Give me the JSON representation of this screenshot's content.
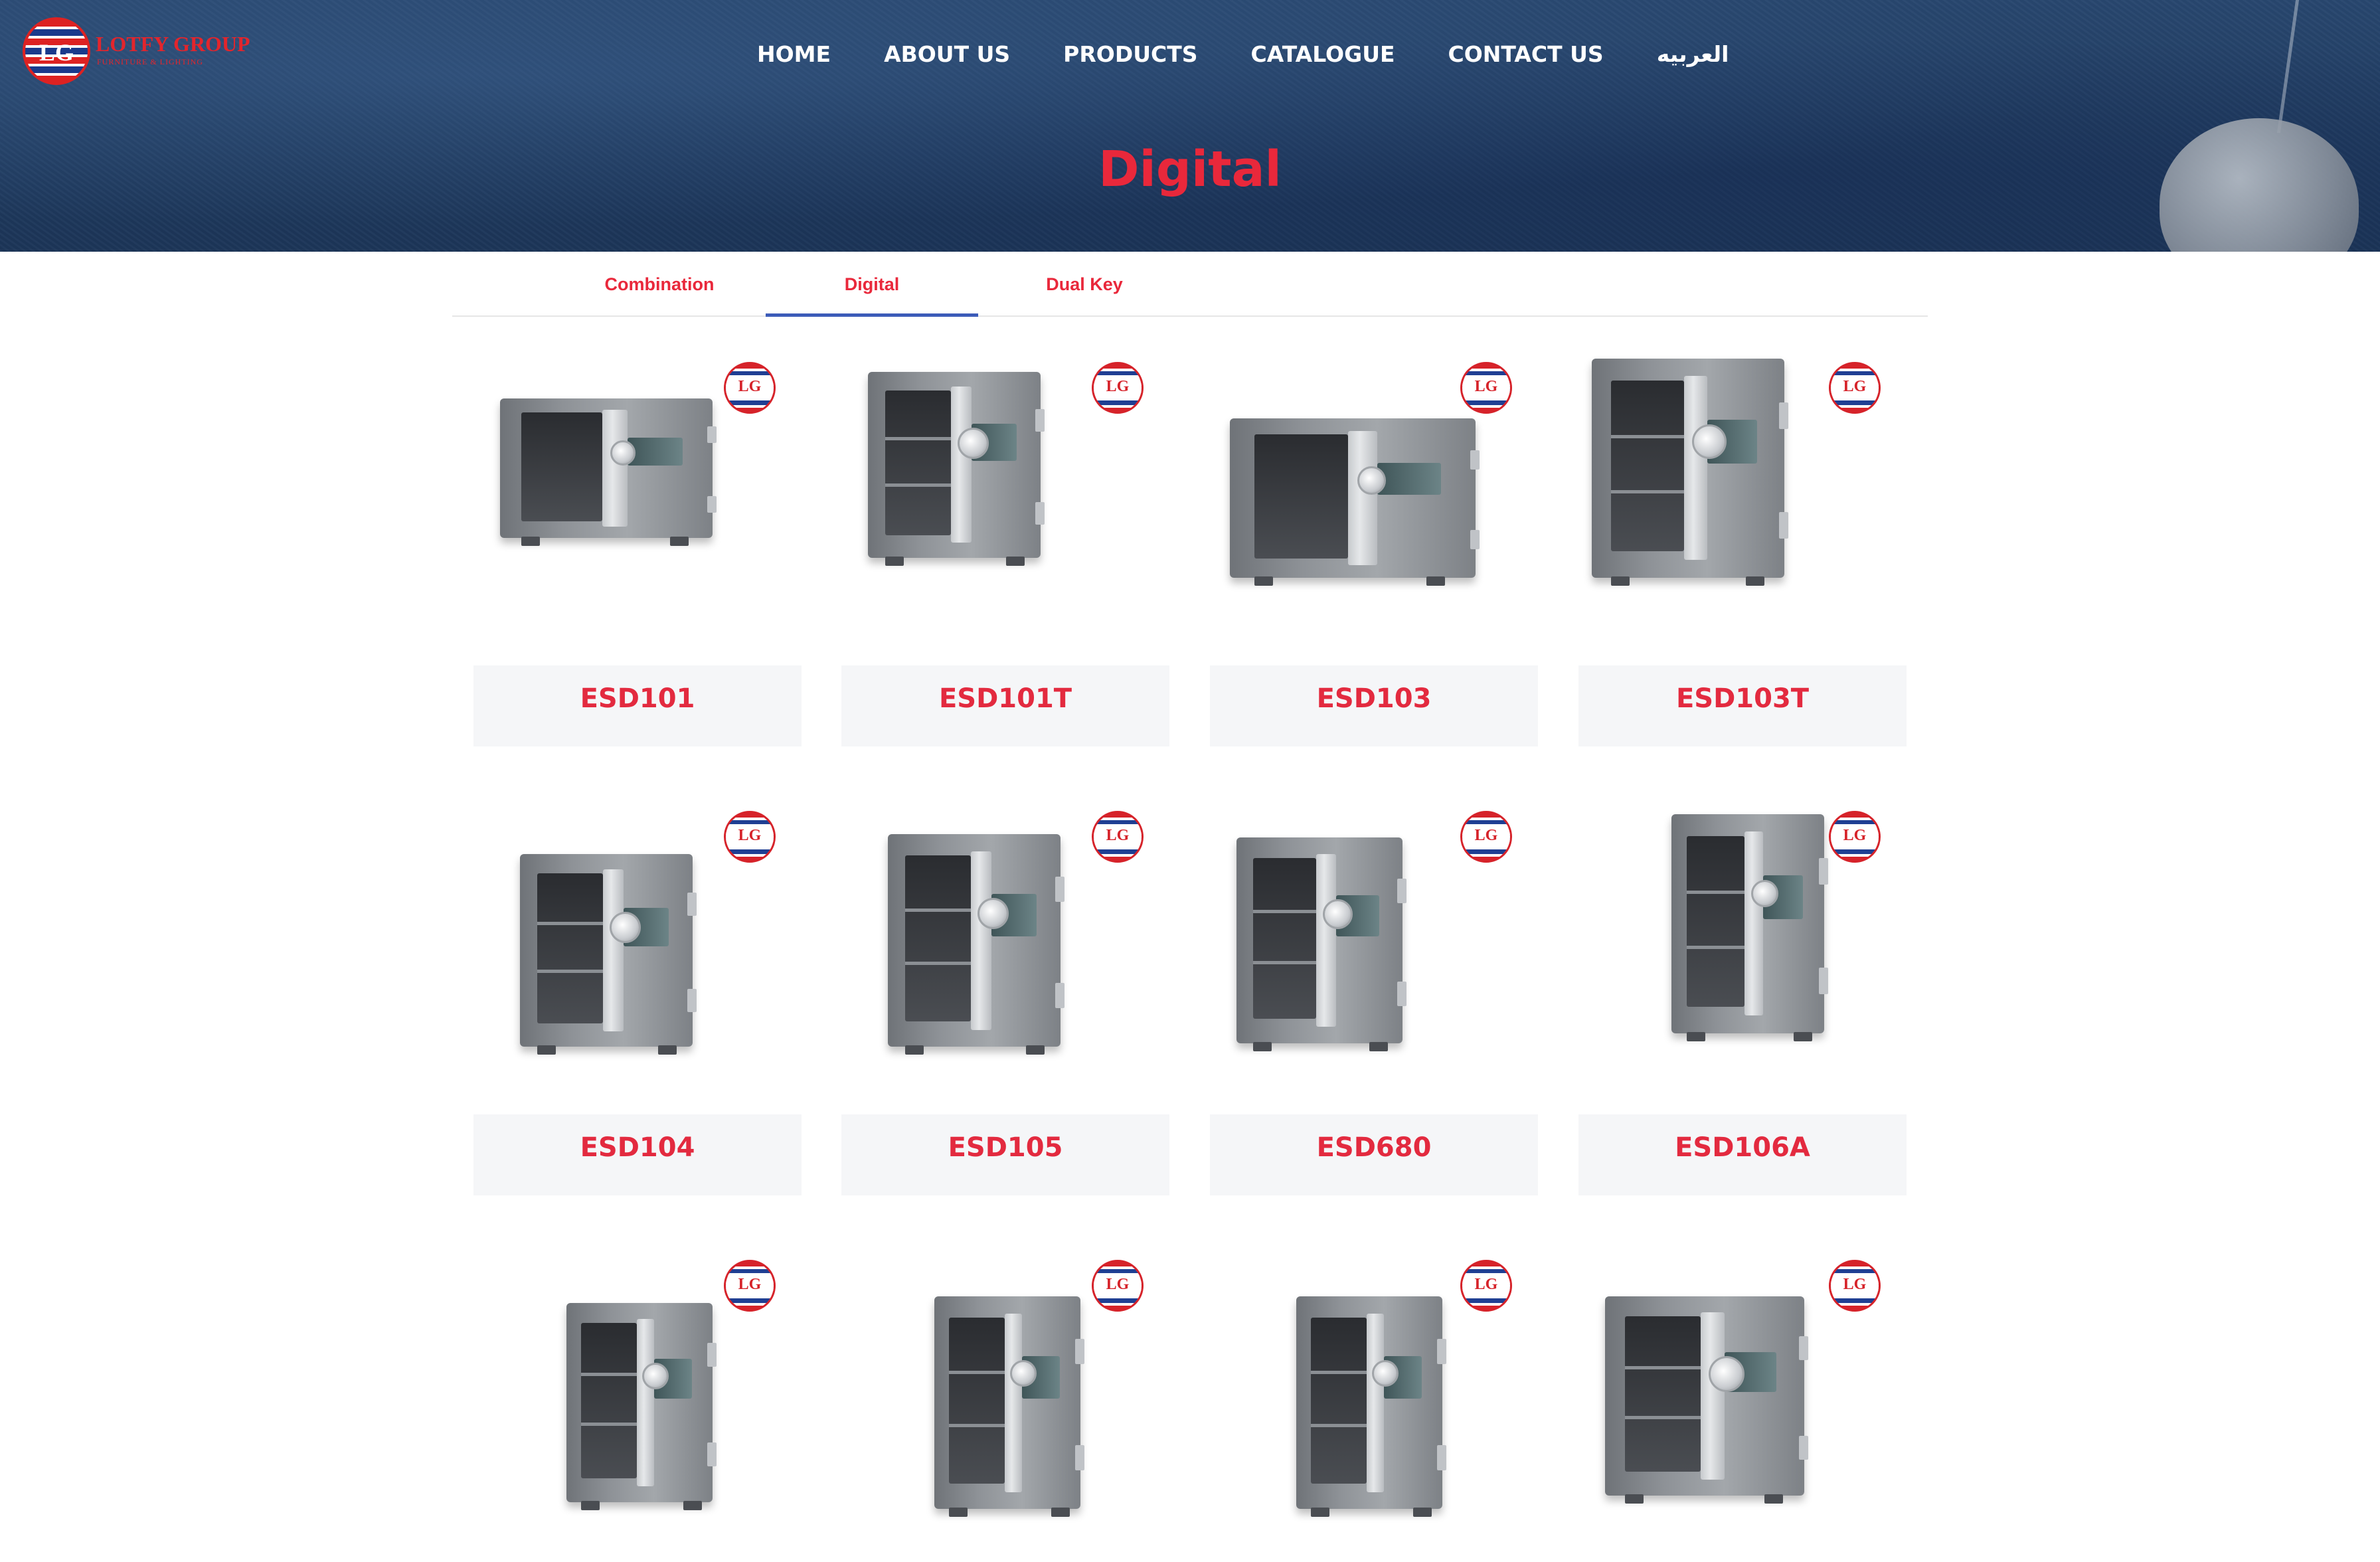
{
  "logo": {
    "mark": "LG",
    "title": "LOTFY GROUP",
    "subtitle": "FURNITURE & LIGHTING"
  },
  "nav": {
    "items": [
      "HOME",
      "ABOUT US",
      "PRODUCTS",
      "CATALOGUE",
      "CONTACT US",
      "العربيه"
    ]
  },
  "page": {
    "title": "Digital"
  },
  "tabs": [
    {
      "label": "Combination",
      "active": false
    },
    {
      "label": "Digital",
      "active": true
    },
    {
      "label": "Dual Key",
      "active": false
    }
  ],
  "badge_text": "LG",
  "products": [
    {
      "name": "ESD101"
    },
    {
      "name": "ESD101T"
    },
    {
      "name": "ESD103"
    },
    {
      "name": "ESD103T"
    },
    {
      "name": "ESD104"
    },
    {
      "name": "ESD105"
    },
    {
      "name": "ESD680"
    },
    {
      "name": "ESD106A"
    },
    {
      "name": ""
    },
    {
      "name": ""
    },
    {
      "name": ""
    },
    {
      "name": ""
    }
  ],
  "colors": {
    "accent_red": "#e9283b",
    "tab_underline": "#3c5bb8",
    "hero_blue": "#213d62",
    "caption_bg": "#f5f6f8"
  }
}
